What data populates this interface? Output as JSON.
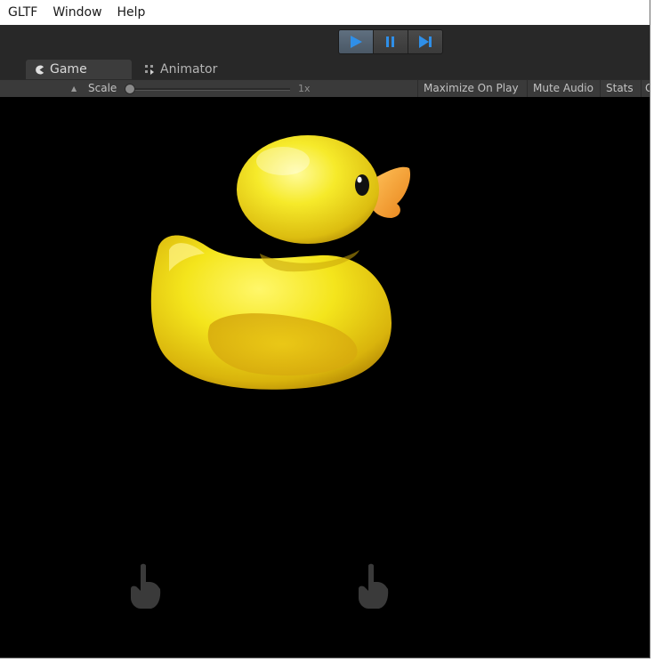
{
  "menu": {
    "items": [
      "GLTF",
      "Window",
      "Help"
    ]
  },
  "playbar": {
    "play_icon": "play-icon",
    "pause_icon": "pause-icon",
    "step_icon": "step-icon",
    "accent_color": "#2f8fe8"
  },
  "tabs": {
    "game": {
      "label": "Game",
      "icon": "game-pacman-icon"
    },
    "animator": {
      "label": "Animator",
      "icon": "animator-grid-icon"
    }
  },
  "gamebar": {
    "scale_label": "Scale",
    "scale_value": "1x",
    "maximize_label": "Maximize On Play",
    "mute_label": "Mute Audio",
    "stats_label": "Stats",
    "extra_label": "G"
  },
  "viewport": {
    "background": "#000000",
    "subject": "rubber-duck",
    "duck_body_color": "#f2e21a",
    "duck_beak_color": "#f5a02a",
    "touch_icons": [
      "touch-hand-icon",
      "touch-hand-icon"
    ]
  }
}
